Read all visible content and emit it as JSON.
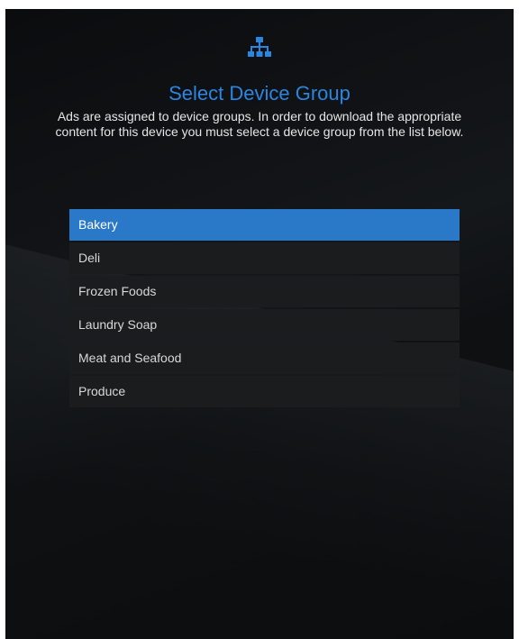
{
  "header": {
    "icon": "sitemap-icon",
    "title": "Select Device Group",
    "description": "Ads are assigned to device groups. In order to download the appropriate content for this device you must select a device group from the list below."
  },
  "device_groups": [
    {
      "label": "Bakery",
      "selected": true
    },
    {
      "label": "Deli",
      "selected": false
    },
    {
      "label": "Frozen Foods",
      "selected": false
    },
    {
      "label": "Laundry Soap",
      "selected": false
    },
    {
      "label": "Meat and Seafood",
      "selected": false
    },
    {
      "label": "Produce",
      "selected": false
    }
  ],
  "colors": {
    "accent": "#2a86e0",
    "selected_row": "#2a78c8",
    "row_background": "#1b1c1e",
    "background": "#0f1113"
  }
}
